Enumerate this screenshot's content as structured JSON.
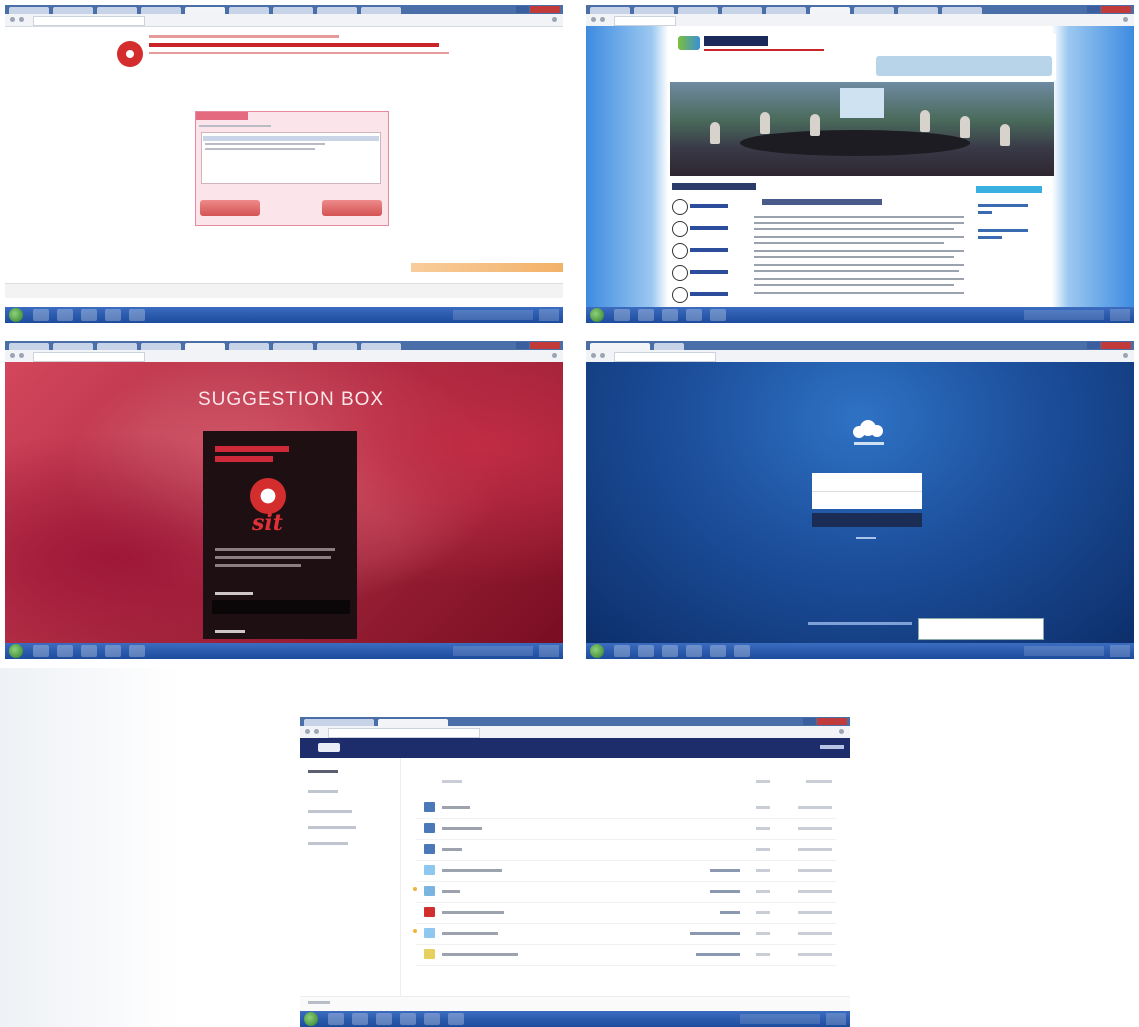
{
  "screenshots": [
    {
      "id": "s1",
      "kind": "college-login-dialog"
    },
    {
      "id": "s2",
      "kind": "virtual-labs-homepage"
    },
    {
      "id": "s3",
      "kind": "suggestion-box",
      "title": "SUGGESTION BOX",
      "panel": {
        "logo_text": "sit"
      }
    },
    {
      "id": "s4",
      "kind": "owncloud-login"
    },
    {
      "id": "s5",
      "kind": "owncloud-files-list"
    }
  ],
  "colors": {
    "taskbar": "#1d4b9c",
    "chrome_tab": "#4a6ea8",
    "college_red": "#c8242a",
    "suggestion_bg": "#c02c44",
    "owncloud_blue": "#1d4f9c",
    "files_header": "#1d2d6c"
  }
}
